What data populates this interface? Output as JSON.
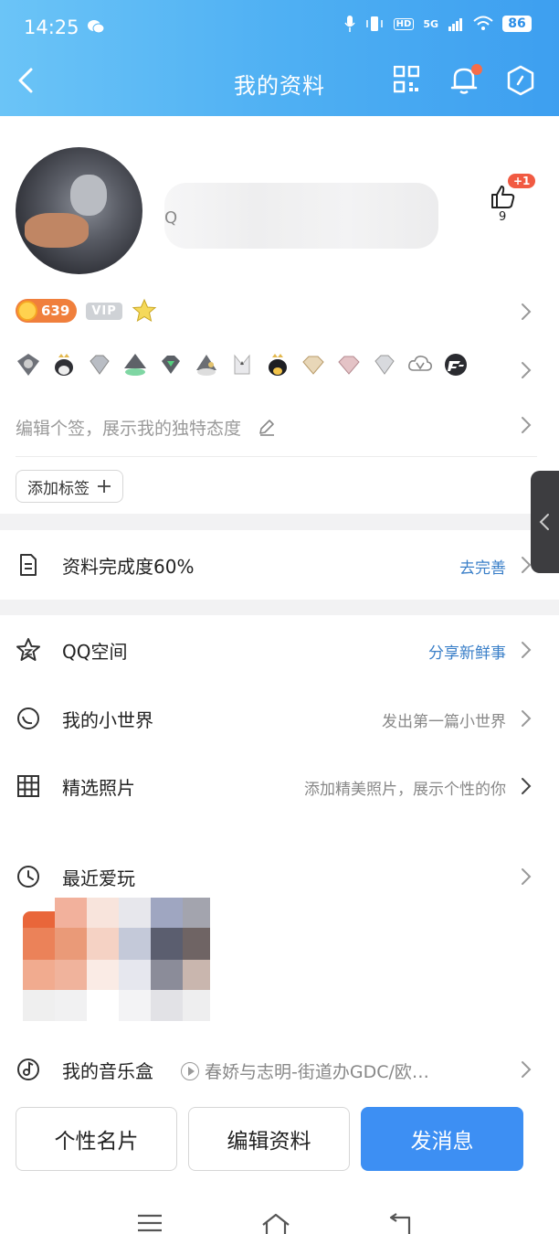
{
  "status_bar": {
    "time": "14:25",
    "battery": "86",
    "network": "5G",
    "hd": "HD"
  },
  "header": {
    "title": "我的资料"
  },
  "profile": {
    "nickname_prefix": "Q",
    "like_badge": "+1",
    "like_count": "9",
    "coin_count": "639",
    "vip_label": "VIP"
  },
  "signature": {
    "placeholder": "编辑个签，展示我的独特态度"
  },
  "tag_button": {
    "label": "添加标签"
  },
  "completion": {
    "label": "资料完成度60%",
    "action": "去完善"
  },
  "rows": {
    "qzone": {
      "label": "QQ空间",
      "hint": "分享新鲜事"
    },
    "world": {
      "label": "我的小世界",
      "hint": "发出第一篇小世界"
    },
    "photos": {
      "label": "精选照片",
      "hint": "添加精美照片，展示个性的你"
    },
    "games": {
      "label": "最近爱玩"
    },
    "music": {
      "label": "我的音乐盒",
      "track": "春娇与志明-街道办GDC/欧…"
    }
  },
  "buttons": {
    "card": "个性名片",
    "edit": "编辑资料",
    "message": "发消息"
  },
  "colors": {
    "header_start": "#6bc4f7",
    "header_end": "#3d9ff0",
    "primary_button": "#3d8ff3",
    "link_blue": "#3a7fc8",
    "notify_dot": "#f56d4a"
  }
}
